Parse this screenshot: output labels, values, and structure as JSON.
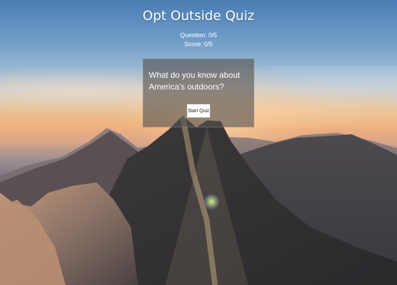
{
  "header": {
    "title": "Opt Outside Quiz",
    "question_counter": "Question: 0/5",
    "score": "Score: 0/5"
  },
  "quiz_card": {
    "question_text": "What do you know about America's outdoors?",
    "start_button_label": "Start Quiz"
  },
  "background": {
    "description_icon": "mountain-landscape-image",
    "accent_colors": [
      "#4a7db3",
      "#f0b27f",
      "#3b3940"
    ]
  }
}
